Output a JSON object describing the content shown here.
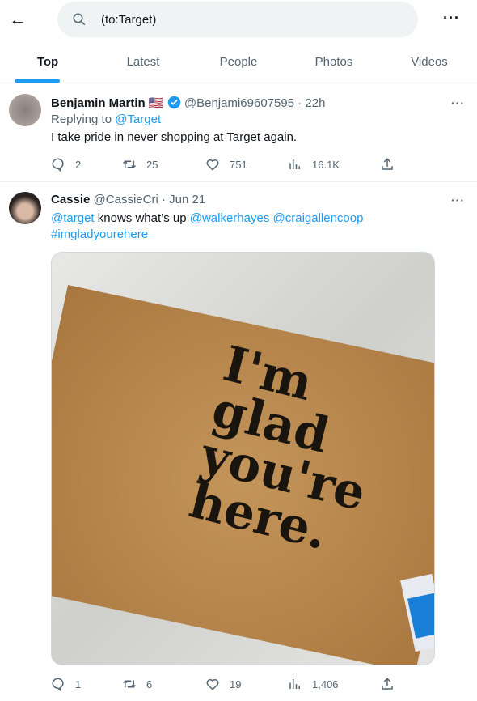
{
  "header": {
    "search_value": "(to:Target)"
  },
  "tabs": [
    {
      "label": "Top",
      "active": true
    },
    {
      "label": "Latest"
    },
    {
      "label": "People"
    },
    {
      "label": "Photos"
    },
    {
      "label": "Videos"
    }
  ],
  "tweets": [
    {
      "name": "Benjamin Martin",
      "flag": "🇺🇸",
      "verified": true,
      "handle": "@Benjami69607595",
      "sep": "·",
      "time": "22h",
      "replying_label": "Replying to",
      "replying_to": "@Target",
      "text": "I take pride in never shopping at Target again.",
      "replies": "2",
      "retweets": "25",
      "likes": "751",
      "views": "16.1K"
    },
    {
      "name": "Cassie",
      "handle": "@CassieCri",
      "sep": "·",
      "time": "Jun 21",
      "mention1": "@target",
      "text_mid": " knows what’s up ",
      "mention2": "@walkerhayes",
      "mention3": "@craigallencoop",
      "hashtag": "#imgladyourehere",
      "image_text": "I'm glad you're here.",
      "replies": "1",
      "retweets": "6",
      "likes": "19",
      "views": "1,406"
    }
  ],
  "colors": {
    "accent": "#1d9bf0",
    "secondary_text": "#536471"
  }
}
